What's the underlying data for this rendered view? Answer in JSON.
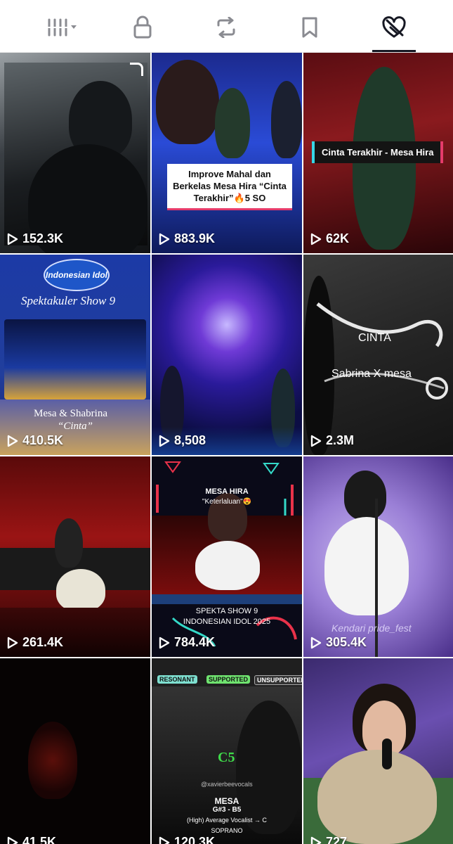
{
  "tabs": [
    {
      "name": "grid-menu",
      "icon": "grid-dropdown-icon"
    },
    {
      "name": "private",
      "icon": "lock-icon"
    },
    {
      "name": "reposts",
      "icon": "repost-icon"
    },
    {
      "name": "favorites",
      "icon": "bookmark-icon"
    },
    {
      "name": "liked",
      "icon": "heart-hidden-icon",
      "active": true
    }
  ],
  "videos": [
    {
      "views": "152.3K"
    },
    {
      "views": "883.9K",
      "overlay": "Improve Mahal dan Berkelas Mesa Hira “Cinta Terakhir”🔥5 SO"
    },
    {
      "views": "62K",
      "overlay": "Cinta Terakhir - Mesa Hira"
    },
    {
      "views": "410.5K",
      "brand": "Indonesian Idol",
      "subtitle": "Spektakuler Show 9",
      "caption1": "Mesa & Shabrina",
      "caption2": "“Cinta”"
    },
    {
      "views": "8,508"
    },
    {
      "views": "2.3M",
      "line1": "CINTA",
      "line2": "Sabrina X mesa"
    },
    {
      "views": "261.4K"
    },
    {
      "views": "784.4K",
      "top1": "MESA HIRA",
      "top2": "\"Keterlaluan\"😍",
      "bottom1": "SPEKTA SHOW 9",
      "bottom2": "INDONESIAN IDOL 2025"
    },
    {
      "views": "305.4K",
      "watermark": "Kendari pride_fest"
    },
    {
      "views": "41.5K"
    },
    {
      "views": "120.3K",
      "tag1": "RESONANT",
      "tag2": "SUPPORTED",
      "tag3": "UNSUPPORTED",
      "note": "C5",
      "name": "MESA",
      "range": "G#3 - B5",
      "desc": "(High) Average Vocalist → C",
      "voice": "SOPRANO",
      "handle": "@xavierbeevocals"
    },
    {
      "views": "727"
    }
  ],
  "colors": {
    "accent": "#161823",
    "background": "#ffffff"
  }
}
